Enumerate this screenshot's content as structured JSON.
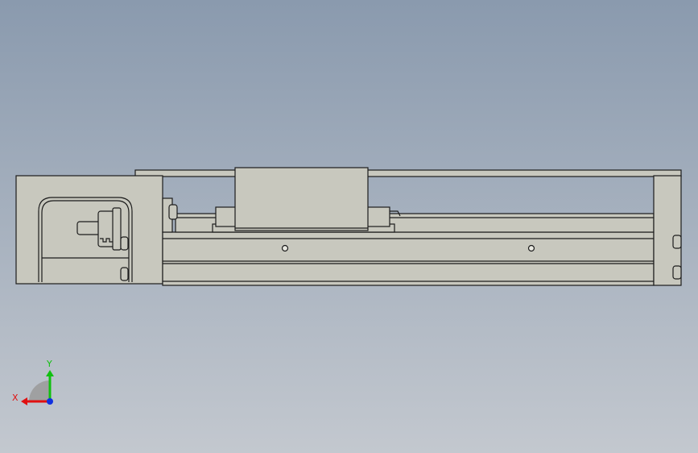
{
  "view": {
    "background_top": "#8a9aae",
    "background_bottom": "#c3c8cf",
    "part_fill": "#c8c8be",
    "part_edge": "#1c1c1c"
  },
  "triad": {
    "x_label": "X",
    "y_label": "Y",
    "x_color": "#e01010",
    "y_color": "#10c010",
    "z_color": "#1030e0"
  }
}
